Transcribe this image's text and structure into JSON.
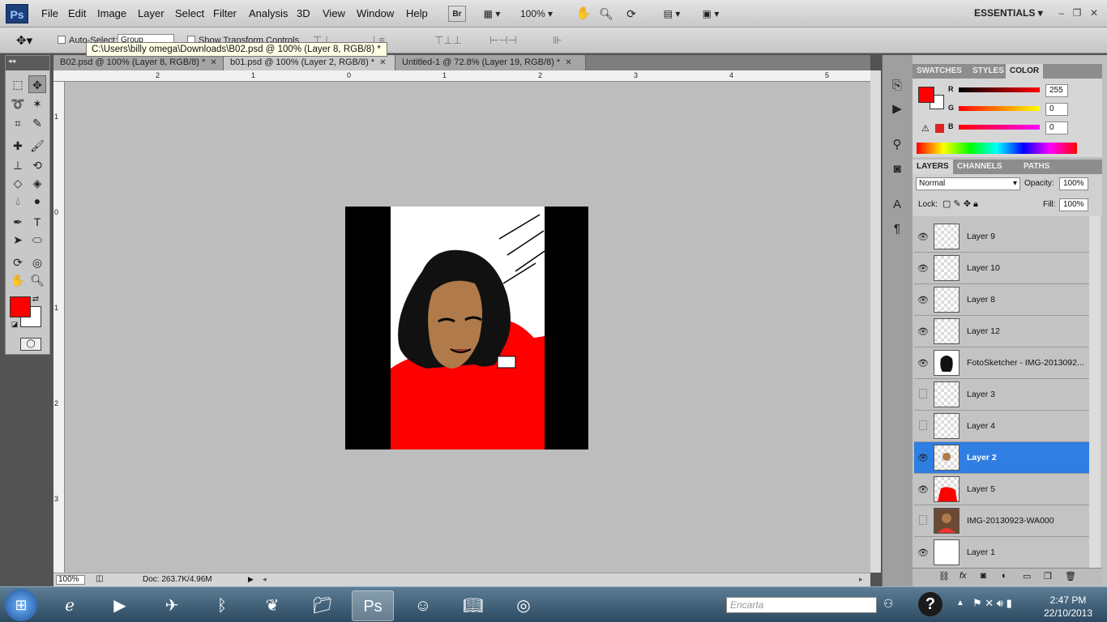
{
  "app": {
    "logo": "Ps"
  },
  "menu": [
    "File",
    "Edit",
    "Image",
    "Layer",
    "Select",
    "Filter",
    "Analysis",
    "3D",
    "View",
    "Window",
    "Help"
  ],
  "toolbar_buttons": {
    "bridge": "Br",
    "zoom_level": "100%",
    "workspace": "ESSENTIALS"
  },
  "options_bar": {
    "auto_select_label": "Auto-Select:",
    "auto_select_value": "Group",
    "show_transform_label": "Show Transform Controls"
  },
  "tooltip": "C:\\Users\\billy omega\\Downloads\\B02.psd @ 100% (Layer 8, RGB/8) *",
  "tabs": [
    {
      "label": "B02.psd @ 100% (Layer 8, RGB/8) *"
    },
    {
      "label": "b01.psd @ 100% (Layer 2, RGB/8) *"
    },
    {
      "label": "Untitled-1 @ 72.8% (Layer 19, RGB/8) *"
    }
  ],
  "ruler_top": [
    "2",
    "1",
    "0",
    "1",
    "2",
    "3",
    "4",
    "5"
  ],
  "ruler_left": [
    "1",
    "0",
    "1",
    "2",
    "3"
  ],
  "status": {
    "zoom": "100%",
    "doc": "Doc: 263.7K/4.96M"
  },
  "color_panel": {
    "tabs": [
      "SWATCHES",
      "STYLES",
      "COLOR"
    ],
    "r_label": "R",
    "g_label": "G",
    "b_label": "B",
    "r": "255",
    "g": "0",
    "b": "0",
    "fg": "#ff0000",
    "bg": "#ffffff"
  },
  "layers_panel": {
    "tabs": [
      "LAYERS",
      "CHANNELS",
      "PATHS"
    ],
    "blend_mode": "Normal",
    "opacity_label": "Opacity:",
    "opacity": "100%",
    "lock_label": "Lock:",
    "fill_label": "Fill:",
    "fill": "100%",
    "layers": [
      {
        "name": "Layer 9",
        "visible": true
      },
      {
        "name": "Layer 10",
        "visible": true
      },
      {
        "name": "Layer 8",
        "visible": true
      },
      {
        "name": "Layer 12",
        "visible": true
      },
      {
        "name": "FotoSketcher - IMG-2013092...",
        "visible": true
      },
      {
        "name": "Layer 3",
        "visible": false
      },
      {
        "name": "Layer 4",
        "visible": false
      },
      {
        "name": "Layer 2",
        "visible": true,
        "selected": true
      },
      {
        "name": "Layer 5",
        "visible": true
      },
      {
        "name": "IMG-20130923-WA000",
        "visible": false
      },
      {
        "name": "Layer 1",
        "visible": true
      }
    ]
  },
  "taskbar": {
    "search": "Encarta",
    "time": "2:47 PM",
    "date": "22/10/2013"
  }
}
